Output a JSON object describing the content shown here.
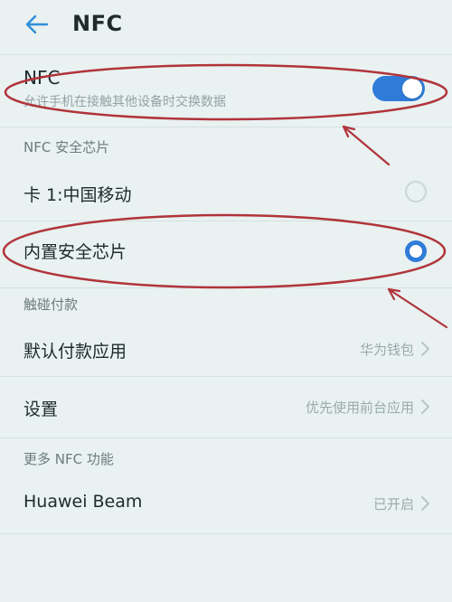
{
  "header": {
    "title": "NFC",
    "back_icon": "arrow-left-icon"
  },
  "nfc_toggle": {
    "label": "NFC",
    "description": "允许手机在接触其他设备时交换数据",
    "state": "on",
    "color": "#2f7cd8"
  },
  "secure_element_section": {
    "title": "NFC 安全芯片",
    "options": [
      {
        "label": "卡 1:中国移动",
        "selected": false
      },
      {
        "label": "内置安全芯片",
        "selected": true
      }
    ]
  },
  "payment_section": {
    "title": "触碰付款",
    "items": [
      {
        "label": "默认付款应用",
        "value": "华为钱包"
      },
      {
        "label": "设置",
        "value": "优先使用前台应用"
      }
    ]
  },
  "more_section": {
    "title": "更多 NFC 功能",
    "items": [
      {
        "label": "Huawei Beam",
        "value": "已开启"
      }
    ]
  },
  "annotations": {
    "color": "#b0343a"
  }
}
